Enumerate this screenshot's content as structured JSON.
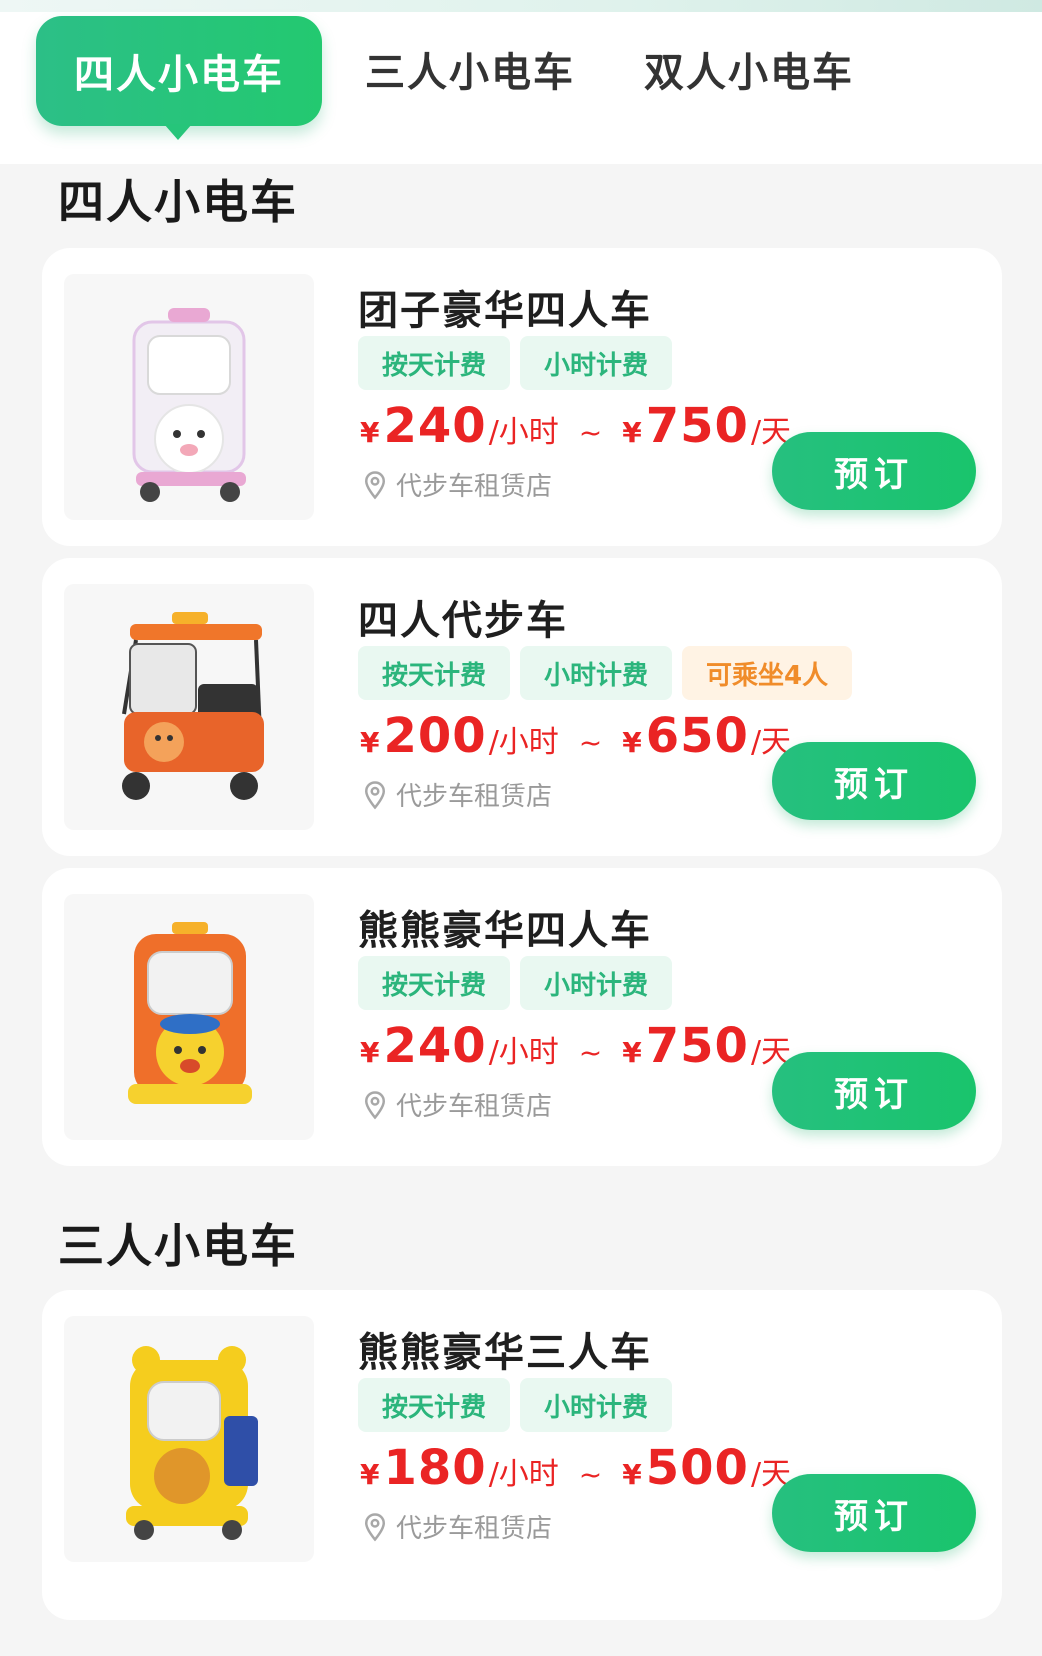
{
  "tabs": [
    {
      "label": "四人小电车",
      "active": true
    },
    {
      "label": "三人小电车",
      "active": false
    },
    {
      "label": "双人小电车",
      "active": false
    }
  ],
  "sections": [
    {
      "title": "四人小电车"
    },
    {
      "title": "三人小电车"
    }
  ],
  "products": [
    {
      "name": "团子豪华四人车",
      "tags": [
        "按天计费",
        "小时计费"
      ],
      "price_hour": "240",
      "price_day": "750",
      "yen": "¥",
      "unit_hour": "/小时",
      "tilde": "~",
      "unit_day": "/天",
      "store": "代步车租赁店",
      "book": "预订",
      "image_icon": "pink-bear-cart-image"
    },
    {
      "name": "四人代步车",
      "tags": [
        "按天计费",
        "小时计费"
      ],
      "extra_tag": "可乘坐4人",
      "price_hour": "200",
      "price_day": "650",
      "yen": "¥",
      "unit_hour": "/小时",
      "tilde": "~",
      "unit_day": "/天",
      "store": "代步车租赁店",
      "book": "预订",
      "image_icon": "orange-buggy-image"
    },
    {
      "name": "熊熊豪华四人车",
      "tags": [
        "按天计费",
        "小时计费"
      ],
      "price_hour": "240",
      "price_day": "750",
      "yen": "¥",
      "unit_hour": "/小时",
      "tilde": "~",
      "unit_day": "/天",
      "store": "代步车租赁店",
      "book": "预订",
      "image_icon": "orange-bear-cart-image"
    },
    {
      "name": "熊熊豪华三人车",
      "tags": [
        "按天计费",
        "小时计费"
      ],
      "price_hour": "180",
      "price_day": "500",
      "yen": "¥",
      "unit_hour": "/小时",
      "tilde": "~",
      "unit_day": "/天",
      "store": "代步车租赁店",
      "book": "预订",
      "image_icon": "yellow-bear-cart-image"
    }
  ],
  "colors": {
    "accent": "#23c970",
    "price": "#ea2424",
    "tag_green_bg": "#e9f8f1",
    "tag_green_fg": "#2bb57c",
    "tag_orange_bg": "#fff3e4",
    "tag_orange_fg": "#f08c2a"
  }
}
